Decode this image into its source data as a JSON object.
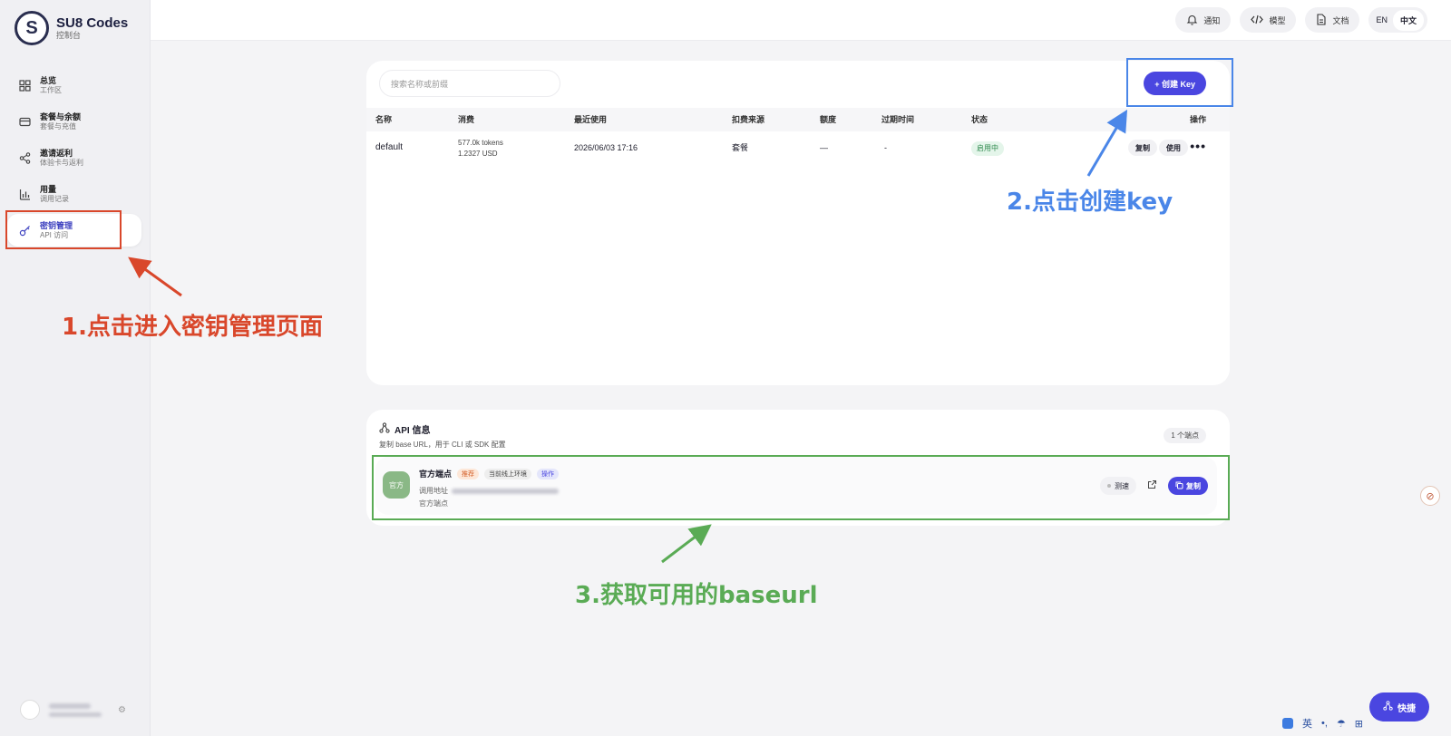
{
  "app": {
    "name": "SU8 Codes",
    "subtitle": "控制台",
    "logo_letter": "S"
  },
  "sidebar": {
    "items": [
      {
        "title": "总览",
        "sub": "工作区",
        "icon": "grid-icon"
      },
      {
        "title": "套餐与余额",
        "sub": "套餐与充值",
        "icon": "card-icon"
      },
      {
        "title": "邀请返利",
        "sub": "体验卡与返利",
        "icon": "share-icon"
      },
      {
        "title": "用量",
        "sub": "调用记录",
        "icon": "chart-icon"
      },
      {
        "title": "密钥管理",
        "sub": "API 访问",
        "icon": "key-icon"
      }
    ],
    "active_index": 4
  },
  "topbar": {
    "notify": "通知",
    "models": "模型",
    "docs": "文档",
    "lang_en": "EN",
    "lang_zh": "中文"
  },
  "keys": {
    "search_placeholder": "搜索名称或前缀",
    "create_label": "+ 创建 Key",
    "columns": [
      "名称",
      "消费",
      "最近使用",
      "扣费来源",
      "额度",
      "过期时间",
      "状态",
      "操作"
    ],
    "rows": [
      {
        "name": "default",
        "tokens": "577.0k tokens",
        "usd": "1.2327 USD",
        "last_used": "2026/06/03 17:16",
        "source": "套餐",
        "quota": "—",
        "expires": "-",
        "status": "启用中",
        "copy": "复制",
        "use": "使用",
        "more": "•••"
      }
    ]
  },
  "api_info": {
    "title": "API 信息",
    "subtitle": "复制 base URL，用于 CLI 或 SDK 配置",
    "count": "1 个端点",
    "endpoint": {
      "badge": "官方",
      "name": "官方端点",
      "tags": [
        "推荐",
        "当前线上环境",
        "操作"
      ],
      "url_label": "调用地址",
      "note": "官方端点",
      "test": "测速",
      "copy": "复制"
    }
  },
  "annotations": {
    "step1": "1.点击进入密钥管理页面",
    "step2": "2.点击创建key",
    "step3": "3.获取可用的baseurl",
    "color_red": "#d9472b",
    "color_blue": "#4a86e8",
    "color_green": "#5aab55"
  },
  "fab": {
    "label": "快捷"
  },
  "ime": {
    "lang": "英"
  },
  "colors": {
    "accent": "#4a46e0",
    "status_green": "#2f8a4e"
  }
}
